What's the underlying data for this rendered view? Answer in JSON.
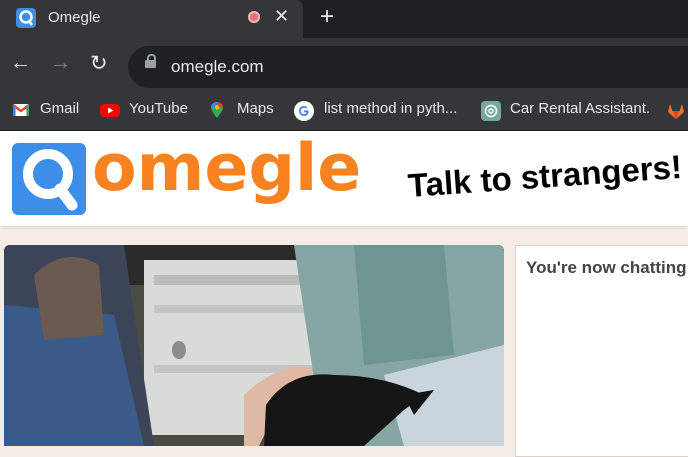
{
  "tab": {
    "title": "Omegle",
    "close_glyph": "✕",
    "new_tab_glyph": "+"
  },
  "toolbar": {
    "back_glyph": "←",
    "forward_glyph": "→",
    "reload_glyph": "↻",
    "url": "omegle.com"
  },
  "bookmarks": [
    {
      "label": "Gmail",
      "icon": "gmail-icon"
    },
    {
      "label": "YouTube",
      "icon": "youtube-icon"
    },
    {
      "label": "Maps",
      "icon": "maps-icon"
    },
    {
      "label": "list method in pyth...",
      "icon": "google-icon"
    },
    {
      "label": "Car Rental Assistant.",
      "icon": "chatgpt-icon"
    }
  ],
  "page": {
    "logo_text": "omegle",
    "tagline": "Talk to strangers!",
    "chat_status": "You're now chatting"
  },
  "colors": {
    "brand_orange": "#f7821f",
    "brand_blue": "#3d8ee8",
    "chrome_dark": "#35363a"
  }
}
